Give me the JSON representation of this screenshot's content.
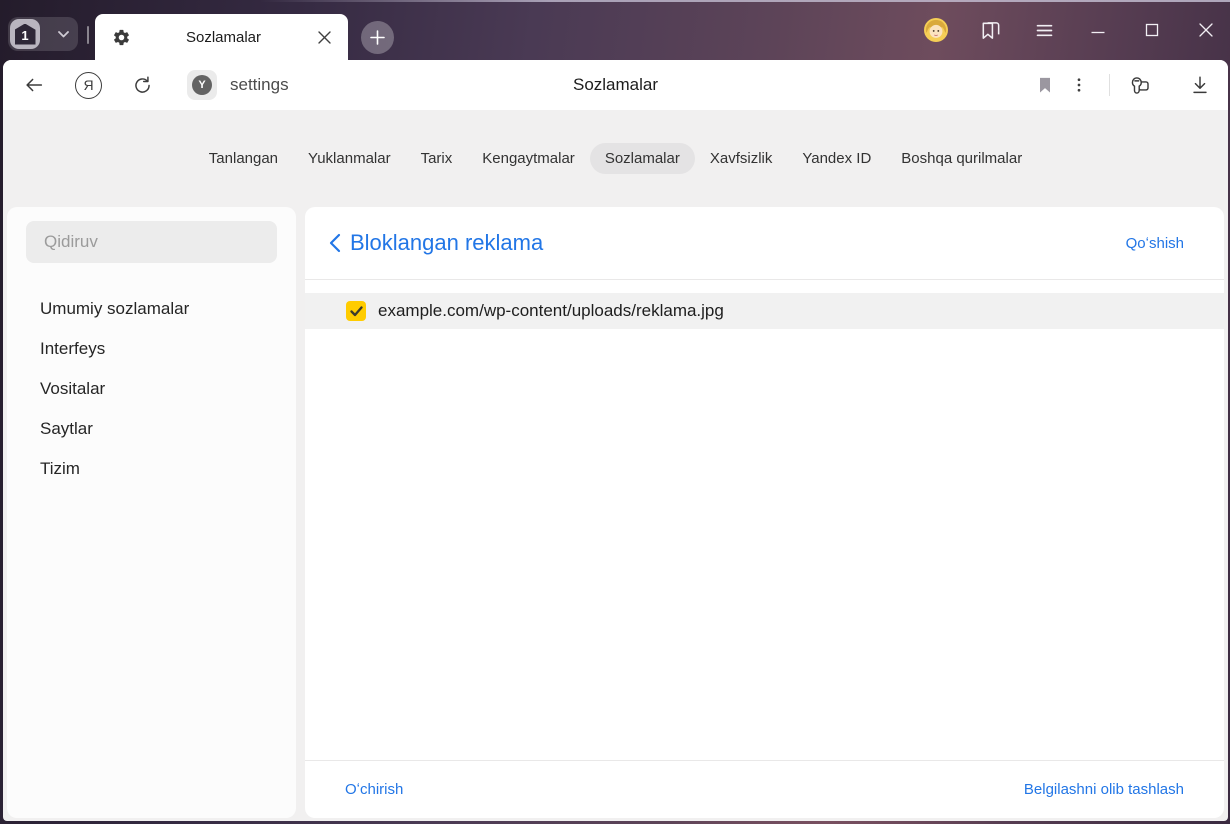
{
  "colors": {
    "accent_blue": "#2276e6",
    "checkbox_yellow": "#ffcc00",
    "chrome_dark_purple": "#241c2b",
    "chrome_rose": "#6e4c5d",
    "panel_gray": "#f1f0f0"
  },
  "chrome": {
    "tab_count": "1",
    "tab": {
      "title": "Sozlamalar"
    },
    "icons": {
      "tab_gear": "gear",
      "tab_close": "x",
      "new_tab": "+",
      "tab_counter_chevron": "chevron-down",
      "avatar": "user-emoji",
      "bookmarks_panel": "bookmark-stack",
      "menu": "hamburger",
      "minimize": "—",
      "maximize": "□",
      "window_close": "✕"
    }
  },
  "toolbar": {
    "back_icon": "arrow-left",
    "yandex_letter": "Я",
    "refresh_icon": "refresh-arrow",
    "favicon_letter": "Y",
    "url_text": "settings",
    "page_title": "Sozlamalar",
    "bookmark_icon": "bookmark-filled",
    "more_icon": "kebab",
    "extensions_icon": "key-card",
    "download_icon": "download-arrow"
  },
  "navtabs": {
    "items": [
      {
        "label": "Tanlangan",
        "selected": false
      },
      {
        "label": "Yuklanmalar",
        "selected": false
      },
      {
        "label": "Tarix",
        "selected": false
      },
      {
        "label": "Kengaytmalar",
        "selected": false
      },
      {
        "label": "Sozlamalar",
        "selected": true
      },
      {
        "label": "Xavfsizlik",
        "selected": false
      },
      {
        "label": "Yandex ID",
        "selected": false
      },
      {
        "label": "Boshqa qurilmalar",
        "selected": false
      }
    ]
  },
  "sidebar": {
    "search_placeholder": "Qidiruv",
    "items": [
      {
        "label": "Umumiy sozlamalar"
      },
      {
        "label": "Interfeys"
      },
      {
        "label": "Vositalar"
      },
      {
        "label": "Saytlar"
      },
      {
        "label": "Tizim"
      }
    ]
  },
  "main": {
    "title": "Bloklangan reklama",
    "add_label": "Qoʻshish",
    "list": [
      {
        "url": "example.com/wp-content/uploads/reklama.jpg",
        "checked": true
      }
    ],
    "footer": {
      "delete_label": "Oʻchirish",
      "clear_label": "Belgilashni olib tashlash"
    }
  }
}
